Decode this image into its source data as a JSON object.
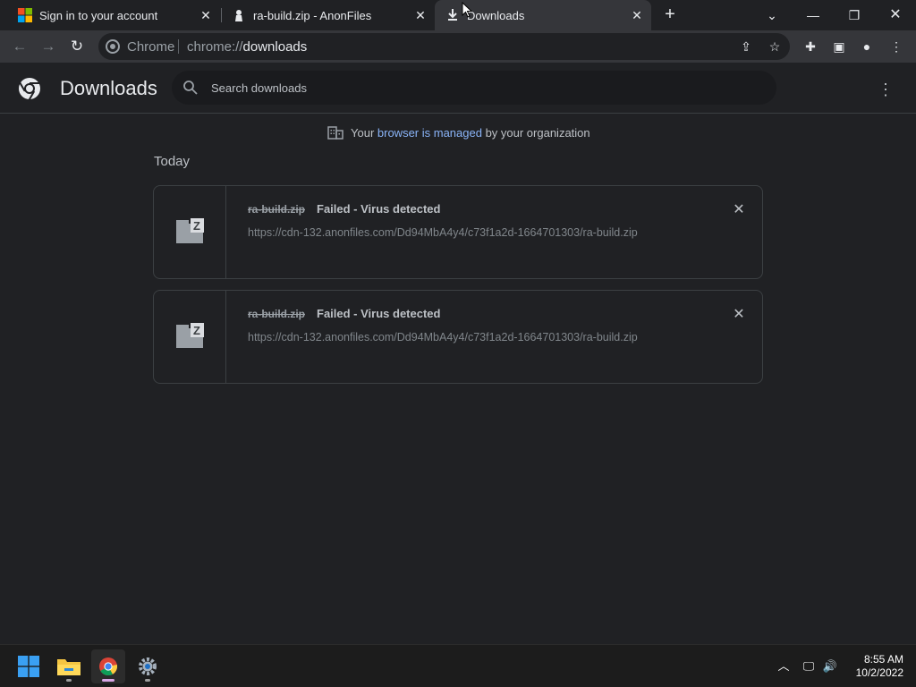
{
  "tabs": [
    {
      "title": "Sign in to your account",
      "icon": "microsoft-icon"
    },
    {
      "title": "ra-build.zip - AnonFiles",
      "icon": "anonfiles-icon"
    },
    {
      "title": "Downloads",
      "icon": "download-icon",
      "active": true
    }
  ],
  "toolbar": {
    "omnibox_label": "Chrome",
    "url_scheme": "chrome://",
    "url_host": "downloads"
  },
  "downloads_page": {
    "title": "Downloads",
    "search_placeholder": "Search downloads",
    "managed_prefix": "Your ",
    "managed_link": "browser is managed",
    "managed_suffix": " by your organization",
    "section": "Today",
    "items": [
      {
        "filename": "ra-build.zip",
        "status": "Failed - Virus detected",
        "url": "https://cdn-132.anonfiles.com/Dd94MbA4y4/c73f1a2d-1664701303/ra-build.zip"
      },
      {
        "filename": "ra-build.zip",
        "status": "Failed - Virus detected",
        "url": "https://cdn-132.anonfiles.com/Dd94MbA4y4/c73f1a2d-1664701303/ra-build.zip"
      }
    ]
  },
  "taskbar": {
    "time": "8:55 AM",
    "date": "10/2/2022"
  },
  "colors": {
    "accent_link": "#8ab4f8",
    "background": "#202124"
  }
}
